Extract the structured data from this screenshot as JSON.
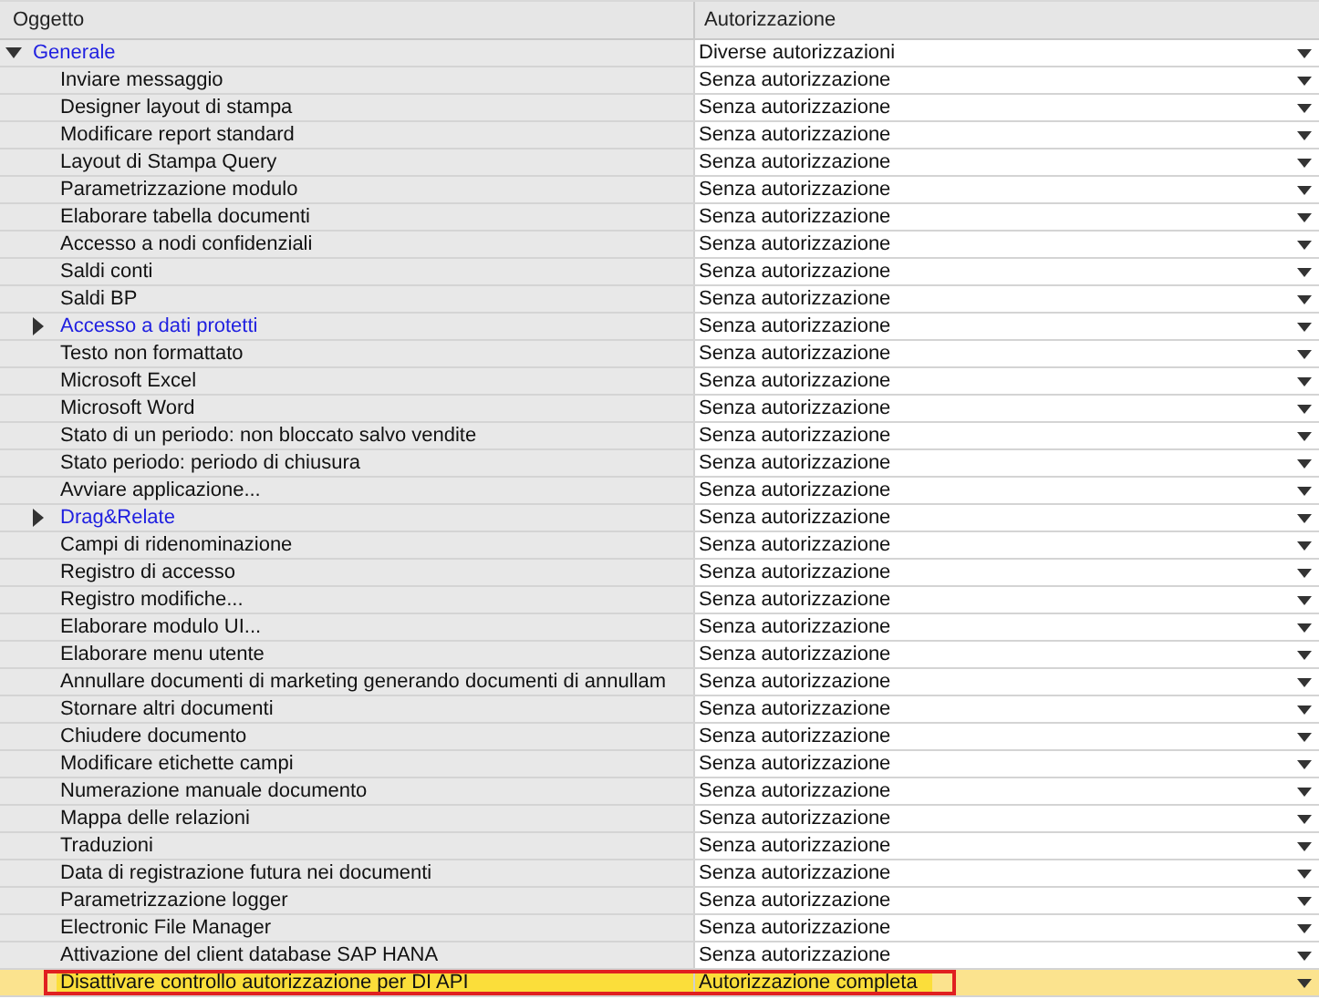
{
  "columns": [
    "Oggetto",
    "Autorizzazione"
  ],
  "rows": [
    {
      "name": "Generale",
      "authorization": "Diverse autorizzazioni",
      "expanded": true,
      "selected": false,
      "children": [
        {
          "name": "Inviare messaggio",
          "authorization": "Senza autorizzazione",
          "selected": false
        },
        {
          "name": "Designer layout di stampa",
          "authorization": "Senza autorizzazione",
          "selected": false
        },
        {
          "name": "Modificare report standard",
          "authorization": "Senza autorizzazione",
          "selected": false
        },
        {
          "name": "Layout di Stampa Query",
          "authorization": "Senza autorizzazione",
          "selected": false
        },
        {
          "name": "Parametrizzazione modulo",
          "authorization": "Senza autorizzazione",
          "selected": false
        },
        {
          "name": "Elaborare tabella documenti",
          "authorization": "Senza autorizzazione",
          "selected": false
        },
        {
          "name": "Accesso a nodi confidenziali",
          "authorization": "Senza autorizzazione",
          "selected": false
        },
        {
          "name": "Saldi conti",
          "authorization": "Senza autorizzazione",
          "selected": false
        },
        {
          "name": "Saldi BP",
          "authorization": "Senza autorizzazione",
          "selected": false
        },
        {
          "name": "Accesso a dati protetti",
          "authorization": "Senza autorizzazione",
          "expanded": false,
          "selected": false
        },
        {
          "name": "Testo non formattato",
          "authorization": "Senza autorizzazione",
          "selected": false
        },
        {
          "name": "Microsoft Excel",
          "authorization": "Senza autorizzazione",
          "selected": false
        },
        {
          "name": "Microsoft Word",
          "authorization": "Senza autorizzazione",
          "selected": false
        },
        {
          "name": "Stato di un periodo: non bloccato salvo vendite",
          "authorization": "Senza autorizzazione",
          "selected": false
        },
        {
          "name": "Stato periodo: periodo di chiusura",
          "authorization": "Senza autorizzazione",
          "selected": false
        },
        {
          "name": "Avviare applicazione...",
          "authorization": "Senza autorizzazione",
          "selected": false
        },
        {
          "name": "Drag&Relate",
          "authorization": "Senza autorizzazione",
          "expanded": false,
          "selected": false
        },
        {
          "name": "Campi di ridenominazione",
          "authorization": "Senza autorizzazione",
          "selected": false
        },
        {
          "name": "Registro di accesso",
          "authorization": "Senza autorizzazione",
          "selected": false
        },
        {
          "name": "Registro modifiche...",
          "authorization": "Senza autorizzazione",
          "selected": false
        },
        {
          "name": "Elaborare modulo UI...",
          "authorization": "Senza autorizzazione",
          "selected": false
        },
        {
          "name": "Elaborare menu utente",
          "authorization": "Senza autorizzazione",
          "selected": false
        },
        {
          "name": "Annullare documenti di marketing generando documenti di annullam",
          "authorization": "Senza autorizzazione",
          "selected": false
        },
        {
          "name": "Stornare altri documenti",
          "authorization": "Senza autorizzazione",
          "selected": false
        },
        {
          "name": "Chiudere documento",
          "authorization": "Senza autorizzazione",
          "selected": false
        },
        {
          "name": "Modificare etichette campi",
          "authorization": "Senza autorizzazione",
          "selected": false
        },
        {
          "name": "Numerazione manuale documento",
          "authorization": "Senza autorizzazione",
          "selected": false
        },
        {
          "name": "Mappa delle relazioni",
          "authorization": "Senza autorizzazione",
          "selected": false
        },
        {
          "name": "Traduzioni",
          "authorization": "Senza autorizzazione",
          "selected": false
        },
        {
          "name": "Data di registrazione futura nei documenti",
          "authorization": "Senza autorizzazione",
          "selected": false
        },
        {
          "name": "Parametrizzazione logger",
          "authorization": "Senza autorizzazione",
          "selected": false
        },
        {
          "name": "Electronic File Manager",
          "authorization": "Senza autorizzazione",
          "selected": false
        },
        {
          "name": "Attivazione del client database SAP HANA",
          "authorization": "Senza autorizzazione",
          "selected": false
        },
        {
          "name": "Disattivare controllo autorizzazione per DI API",
          "authorization": "Autorizzazione completa",
          "selected": true
        }
      ]
    }
  ]
}
